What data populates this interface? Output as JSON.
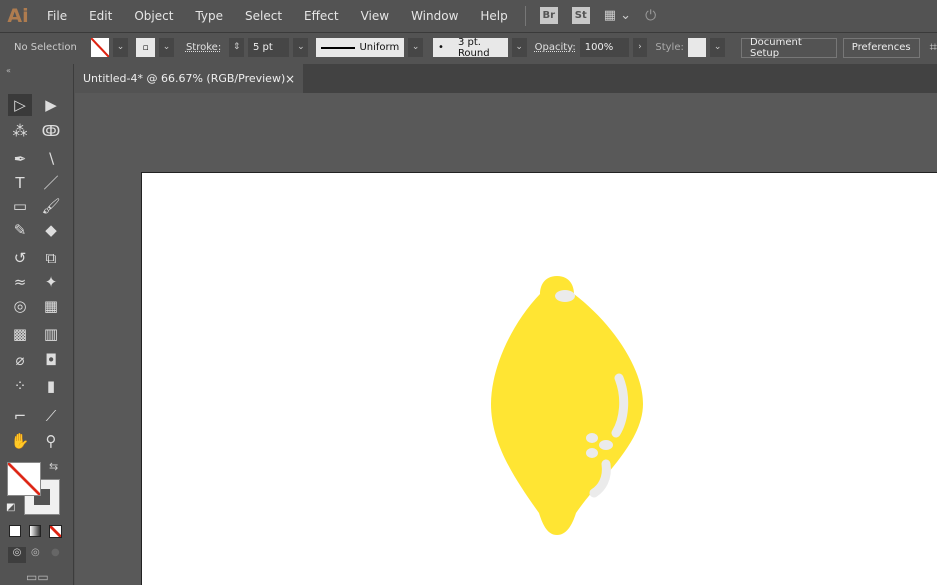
{
  "app": {
    "logo": "Ai"
  },
  "menu": [
    "File",
    "Edit",
    "Object",
    "Type",
    "Select",
    "Effect",
    "View",
    "Window",
    "Help"
  ],
  "menu_icons": {
    "bridge": "Br",
    "stock": "St"
  },
  "control": {
    "selection": "No Selection",
    "stroke_label": "Stroke:",
    "stroke_value": "5 pt",
    "profile": "Uniform",
    "brush": "3 pt. Round",
    "opacity_label": "Opacity:",
    "opacity_value": "100%",
    "style_label": "Style:",
    "document_setup": "Document Setup",
    "preferences": "Preferences"
  },
  "document": {
    "tab_title": "Untitled-4* @ 66.67% (RGB/Preview)",
    "close": "×"
  },
  "artwork": {
    "lemon_color": "#FFE533",
    "highlight_color": "#EBEBEB"
  },
  "tools": [
    {
      "name": "selection-tool",
      "glyph": "▷"
    },
    {
      "name": "direct-selection-tool",
      "glyph": "▶"
    },
    {
      "name": "magic-wand-tool",
      "glyph": "⁂"
    },
    {
      "name": "lasso-tool",
      "glyph": "ↂ"
    },
    {
      "name": "pen-tool",
      "glyph": "✒"
    },
    {
      "name": "curvature-tool",
      "glyph": "∖"
    },
    {
      "name": "type-tool",
      "glyph": "T"
    },
    {
      "name": "line-tool",
      "glyph": "／"
    },
    {
      "name": "rectangle-tool",
      "glyph": "▭"
    },
    {
      "name": "paintbrush-tool",
      "glyph": "🖌"
    },
    {
      "name": "shaper-tool",
      "glyph": "✎"
    },
    {
      "name": "eraser-tool",
      "glyph": "◆"
    },
    {
      "name": "rotate-tool",
      "glyph": "↺"
    },
    {
      "name": "scale-tool",
      "glyph": "⧉"
    },
    {
      "name": "warp-tool",
      "glyph": "≈"
    },
    {
      "name": "puppet-warp-tool",
      "glyph": "✦"
    },
    {
      "name": "shape-builder-tool",
      "glyph": "◎"
    },
    {
      "name": "perspective-grid-tool",
      "glyph": "▦"
    },
    {
      "name": "mesh-tool",
      "glyph": "▩"
    },
    {
      "name": "gradient-tool",
      "glyph": "▥"
    },
    {
      "name": "eyedropper-tool",
      "glyph": "⌀"
    },
    {
      "name": "blend-tool",
      "glyph": "◘"
    },
    {
      "name": "symbol-sprayer-tool",
      "glyph": "⁘"
    },
    {
      "name": "column-graph-tool",
      "glyph": "▮"
    },
    {
      "name": "artboard-tool",
      "glyph": "⌐"
    },
    {
      "name": "slice-tool",
      "glyph": "⟋"
    },
    {
      "name": "hand-tool",
      "glyph": "✋"
    },
    {
      "name": "zoom-tool",
      "glyph": "⚲"
    }
  ]
}
